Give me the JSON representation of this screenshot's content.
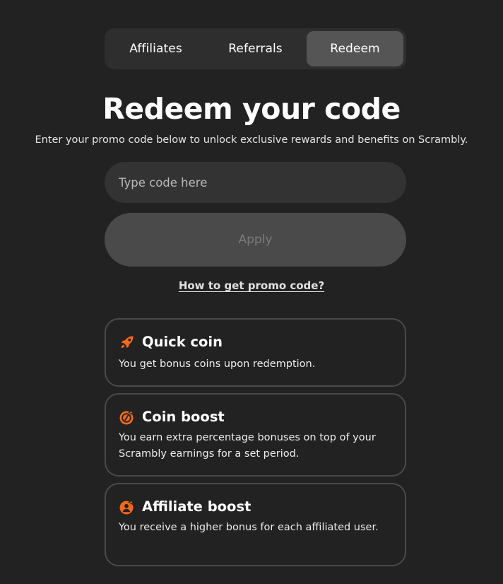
{
  "tabs": [
    {
      "label": "Affiliates",
      "active": false
    },
    {
      "label": "Referrals",
      "active": false
    },
    {
      "label": "Redeem",
      "active": true
    }
  ],
  "heading": {
    "title": "Redeem your code",
    "subtitle": "Enter your promo code below to unlock exclusive rewards and benefits on Scrambly."
  },
  "form": {
    "code_value": "",
    "code_placeholder": "Type code here",
    "apply_label": "Apply"
  },
  "help_link": "How to get promo code?",
  "colors": {
    "accent": "#f26a1b",
    "background": "#222222",
    "card_border": "#4a4a4a",
    "active_tab": "#555555"
  },
  "benefits": [
    {
      "icon": "rocket-icon",
      "title": "Quick coin",
      "description": "You get bonus coins upon redemption."
    },
    {
      "icon": "coin-boost-icon",
      "title": "Coin boost",
      "description": "You earn extra percentage bonuses on top of your Scrambly earnings for a set period."
    },
    {
      "icon": "affiliate-boost-icon",
      "title": "Affiliate boost",
      "description": "You receive a higher bonus for each affiliated user."
    }
  ]
}
